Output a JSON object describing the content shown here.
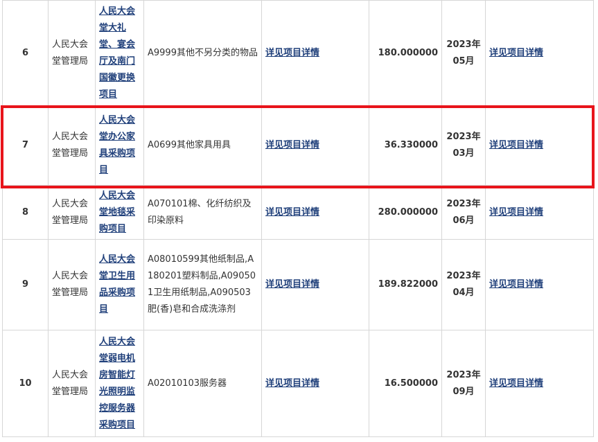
{
  "rows": [
    {
      "num": "6",
      "unit": "人民大会堂管理局",
      "project": "人民大会堂大礼堂、宴会厅及南门国徽更换项目",
      "category": "A9999其他不另分类的物品",
      "content": "详见项目详情",
      "budget": "180.000000",
      "time": "2023年05月",
      "remark": "详见项目详情"
    },
    {
      "num": "7",
      "unit": "人民大会堂管理局",
      "project": "人民大会堂办公家具采购项目",
      "category": "A0699其他家具用具",
      "content": "详见项目详情",
      "budget": "36.330000",
      "time": "2023年03月",
      "remark": "详见项目详情"
    },
    {
      "num": "8",
      "unit": "人民大会堂管理局",
      "project": "人民大会堂地毯采购项目",
      "category": "A070101棉、化纤纺织及印染原料",
      "content": "详见项目详情",
      "budget": "280.000000",
      "time": "2023年06月",
      "remark": "详见项目详情"
    },
    {
      "num": "9",
      "unit": "人民大会堂管理局",
      "project": "人民大会堂卫生用品采购项目",
      "category": "A08010599其他纸制品,A180201塑料制品,A090501卫生用纸制品,A090503肥(香)皂和合成洗涤剂",
      "content": "详见项目详情",
      "budget": "189.822000",
      "time": "2023年04月",
      "remark": "详见项目详情"
    },
    {
      "num": "10",
      "unit": "人民大会堂管理局",
      "project": "人民大会堂弱电机房智能灯光照明监控服务器采购项目",
      "category": "A02010103服务器",
      "content": "详见项目详情",
      "budget": "16.500000",
      "time": "2023年09月",
      "remark": "详见项目详情"
    }
  ],
  "highlight_color": "#e8141b",
  "link_color": "#1f3f7a"
}
